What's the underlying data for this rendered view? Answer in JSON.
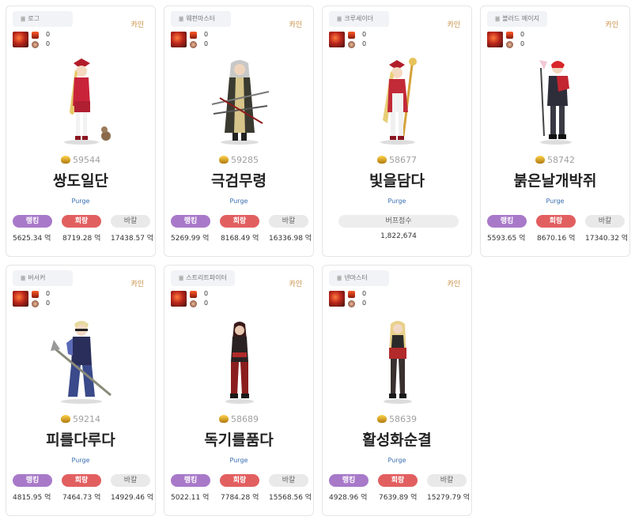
{
  "cards": [
    {
      "job": "로그",
      "server": "카인",
      "count1": "0",
      "count2": "0",
      "score": "59544",
      "name": "쌍도일단",
      "guild": "Purge",
      "labels": [
        "랭킹",
        "회랑",
        "바칼"
      ],
      "values": [
        "5625.34 억",
        "8719.28 억",
        "17438.57 억"
      ]
    },
    {
      "job": "웨펀마스터",
      "server": "카인",
      "count1": "0",
      "count2": "0",
      "score": "59285",
      "name": "극검무령",
      "guild": "Purge",
      "labels": [
        "랭킹",
        "회랑",
        "바칼"
      ],
      "values": [
        "5269.99 억",
        "8168.49 억",
        "16336.98 억"
      ]
    },
    {
      "job": "크루세이더",
      "server": "카인",
      "count1": "0",
      "count2": "0",
      "score": "58677",
      "name": "빛을담다",
      "guild": "Purge",
      "buff_label": "버프점수",
      "buff_value": "1,822,674"
    },
    {
      "job": "블러드 메이지",
      "server": "카인",
      "count1": "0",
      "count2": "0",
      "score": "58742",
      "name": "붉은날개박쥐",
      "guild": "Purge",
      "labels": [
        "랭킹",
        "회랑",
        "바칼"
      ],
      "values": [
        "5593.65 억",
        "8670.16 억",
        "17340.32 억"
      ]
    },
    {
      "job": "버서커",
      "server": "카인",
      "count1": "0",
      "count2": "0",
      "score": "59214",
      "name": "피를다루다",
      "guild": "Purge",
      "labels": [
        "랭킹",
        "회랑",
        "바칼"
      ],
      "values": [
        "4815.95 억",
        "7464.73 억",
        "14929.46 억"
      ]
    },
    {
      "job": "스트리트파이터",
      "server": "카인",
      "count1": "0",
      "count2": "0",
      "score": "58689",
      "name": "독기를품다",
      "guild": "Purge",
      "labels": [
        "랭킹",
        "회랑",
        "바칼"
      ],
      "values": [
        "5022.11 억",
        "7784.28 억",
        "15568.56 억"
      ]
    },
    {
      "job": "넨마스터",
      "server": "카인",
      "count1": "0",
      "count2": "0",
      "score": "58639",
      "name": "활성화순결",
      "guild": "Purge",
      "labels": [
        "랭킹",
        "회랑",
        "바칼"
      ],
      "values": [
        "4928.96 억",
        "7639.89 억",
        "15279.79 억"
      ]
    }
  ]
}
